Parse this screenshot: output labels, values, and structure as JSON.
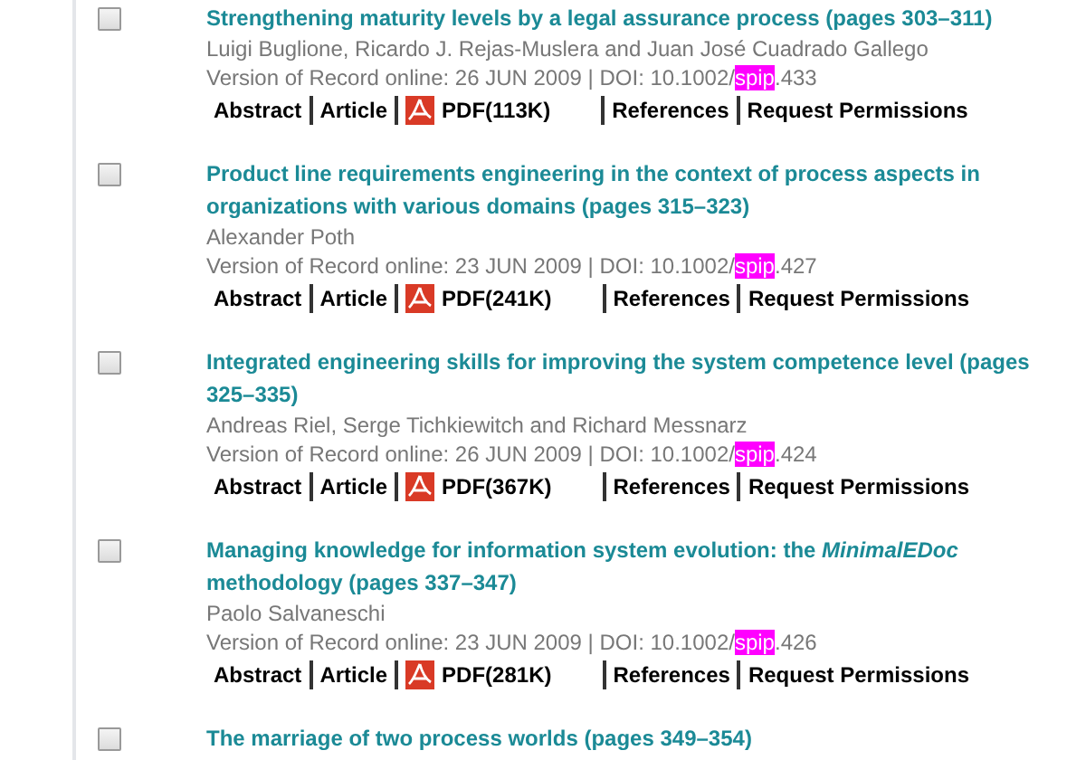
{
  "articles": [
    {
      "title": "Strengthening maturity levels by a legal assurance process (pages 303–311)",
      "authors": "Luigi Buglione, Ricardo J. Rejas-Muslera and Juan José Cuadrado Gallego",
      "record": "Version of Record online: 26 JUN 2009 | DOI: 10.1002/",
      "highlight": "spip",
      "doi_end": ".433",
      "checked": false,
      "links": [
        {
          "kind": "text",
          "label": "Abstract"
        },
        {
          "kind": "text",
          "label": "Article"
        },
        {
          "kind": "pdf",
          "label": "PDF(113K)"
        },
        {
          "kind": "text",
          "label": "References"
        },
        {
          "kind": "text",
          "label": "Request Permissions"
        }
      ]
    },
    {
      "title": "Product line requirements engineering in the context of process aspects in organizations with various domains (pages 315–323)",
      "authors": "Alexander Poth",
      "record": "Version of Record online: 23 JUN 2009 | DOI: 10.1002/",
      "highlight": "spip",
      "doi_end": ".427",
      "checked": false,
      "links": [
        {
          "kind": "text",
          "label": "Abstract"
        },
        {
          "kind": "text",
          "label": "Article"
        },
        {
          "kind": "pdf",
          "label": "PDF(241K)"
        },
        {
          "kind": "text",
          "label": "References"
        },
        {
          "kind": "text",
          "label": "Request Permissions"
        }
      ]
    },
    {
      "title": "Integrated engineering skills for improving the system competence level (pages 325–335)",
      "authors": "Andreas Riel, Serge Tichkiewitch and Richard Messnarz",
      "record": "Version of Record online: 26 JUN 2009 | DOI: 10.1002/",
      "highlight": "spip",
      "doi_end": ".424",
      "checked": false,
      "links": [
        {
          "kind": "text",
          "label": "Abstract"
        },
        {
          "kind": "text",
          "label": "Article"
        },
        {
          "kind": "pdf",
          "label": "PDF(367K)"
        },
        {
          "kind": "text",
          "label": "References"
        },
        {
          "kind": "text",
          "label": "Request Permissions"
        }
      ]
    },
    {
      "title": "Managing knowledge for information system evolution: the *MinimalEDoc* methodology (pages 337–347)",
      "authors": "Paolo Salvaneschi",
      "record": "Version of Record online: 23 JUN 2009 | DOI: 10.1002/",
      "highlight": "spip",
      "doi_end": ".426",
      "checked": false,
      "links": [
        {
          "kind": "text",
          "label": "Abstract"
        },
        {
          "kind": "text",
          "label": "Article"
        },
        {
          "kind": "pdf",
          "label": "PDF(281K)"
        },
        {
          "kind": "text",
          "label": "References"
        },
        {
          "kind": "text",
          "label": "Request Permissions"
        }
      ]
    },
    {
      "title": "The marriage of two process worlds (pages 349–354)",
      "checked": false
    }
  ]
}
